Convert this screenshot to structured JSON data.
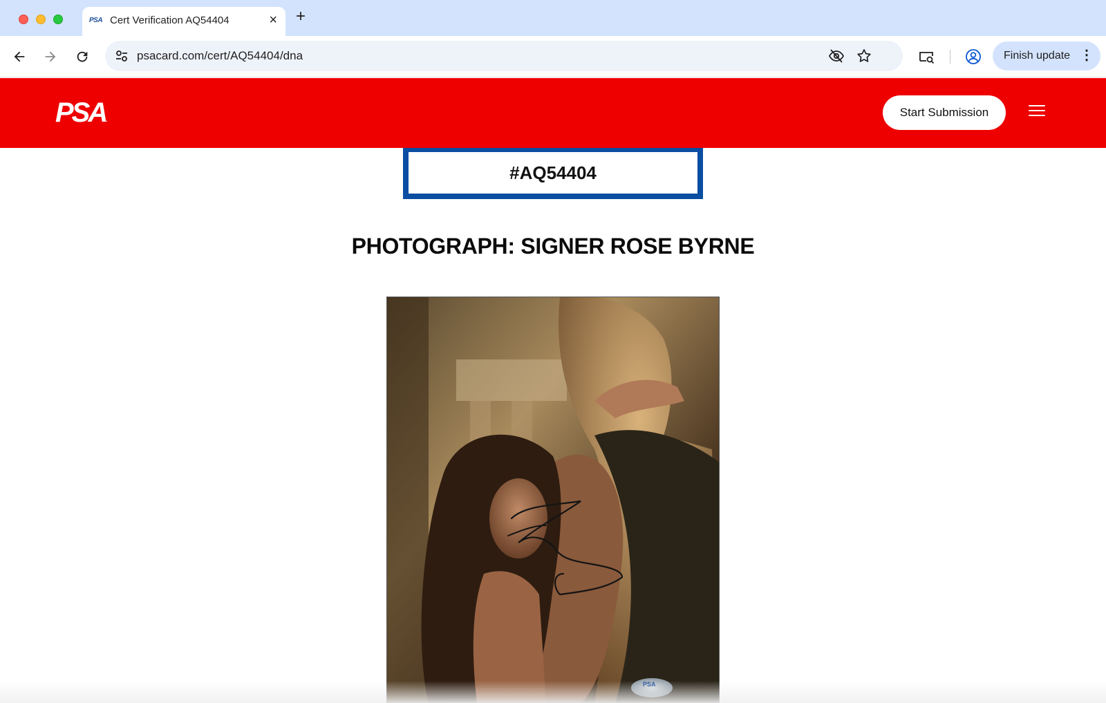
{
  "browser": {
    "tab": {
      "favicon": "PSA",
      "title": "Cert Verification AQ54404"
    },
    "url": "psacard.com/cert/AQ54404/dna",
    "finish_update_label": "Finish update",
    "icons": {
      "back": "back-arrow-icon",
      "forward": "forward-arrow-icon",
      "reload": "reload-icon",
      "site_info": "tune-icon",
      "eye_off": "eye-off-icon",
      "bookmark": "star-icon",
      "media": "cast-search-icon",
      "profile": "account-circle-icon",
      "menu": "more-vert-icon"
    }
  },
  "header": {
    "logo": "PSA",
    "start_submission_label": "Start Submission",
    "brand_color": "#ee0000"
  },
  "cert": {
    "number": "#AQ54404",
    "border_color": "#0a4ea2"
  },
  "item": {
    "title": "PHOTOGRAPH: SIGNER ROSE BYRNE"
  },
  "photo": {
    "hologram_text": "PSA"
  }
}
